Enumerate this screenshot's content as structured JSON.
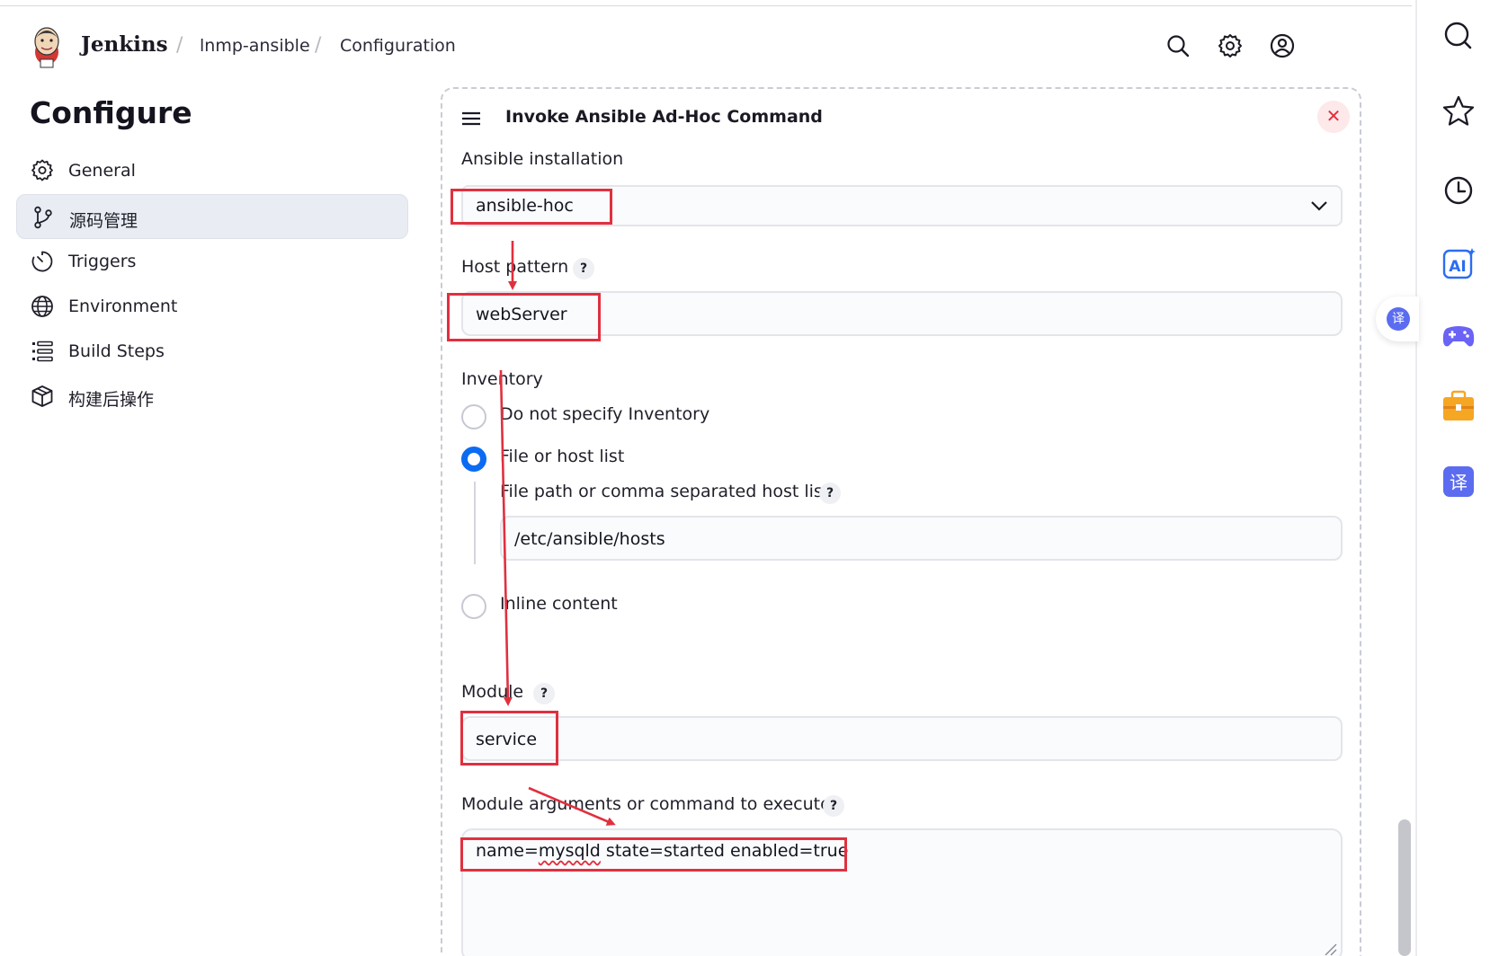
{
  "header": {
    "brand": "Jenkins",
    "breadcrumbs": [
      "lnmp-ansible",
      "Configuration"
    ],
    "separator": "/"
  },
  "sidebar": {
    "title": "Configure",
    "items": [
      {
        "label": "General",
        "icon": "gear-icon"
      },
      {
        "label": "源码管理",
        "icon": "git-branch-icon",
        "active": true
      },
      {
        "label": "Triggers",
        "icon": "timer-icon"
      },
      {
        "label": "Environment",
        "icon": "globe-icon"
      },
      {
        "label": "Build Steps",
        "icon": "list-icon"
      },
      {
        "label": "构建后操作",
        "icon": "package-icon"
      }
    ]
  },
  "step": {
    "title": "Invoke Ansible Ad-Hoc Command",
    "close_label": "✕",
    "ansible_installation": {
      "label": "Ansible installation",
      "value": "ansible-hoc"
    },
    "host_pattern": {
      "label": "Host pattern",
      "value": "webServer",
      "help": "?"
    },
    "inventory": {
      "label": "Inventory",
      "options": [
        "Do not specify Inventory",
        "File or host list",
        "Inline content"
      ],
      "selected": "File or host list",
      "file_path_label": "File path or comma separated host list",
      "file_path_value": "/etc/ansible/hosts",
      "help": "?"
    },
    "module": {
      "label": "Module",
      "value": "service",
      "help": "?"
    },
    "module_args": {
      "label": "Module arguments or command to execute",
      "value_prefix": "name=",
      "value_misspelled": "mysqld",
      "value_suffix": " state=started enabled=true",
      "help": "?"
    }
  },
  "colors": {
    "accent": "#0b6cf2",
    "annotation_red": "#e0303f",
    "active_nav_bg": "#e9ecf3"
  },
  "browser_rail": {
    "icons": [
      "search-icon",
      "star-icon",
      "history-icon",
      "ai-icon",
      "game-controller-icon",
      "toolbox-icon",
      "translate-icon"
    ],
    "ai_label": "AI",
    "translate_label": "译"
  }
}
